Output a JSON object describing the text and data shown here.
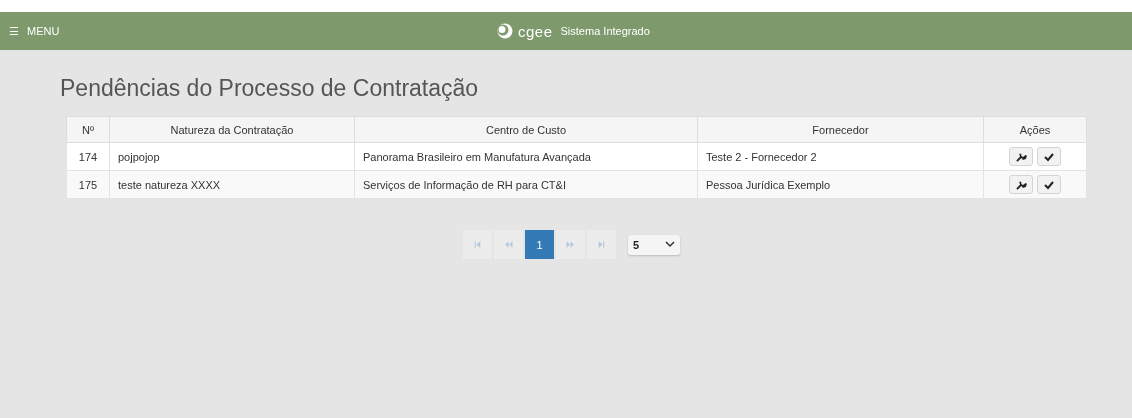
{
  "header": {
    "menu_icon": "☰",
    "menu_label": "MENU",
    "brand": "cgee",
    "app_name": "Sistema Integrado"
  },
  "title": "Pendências do Processo de Contratação",
  "table": {
    "columns": [
      "Nº",
      "Natureza da Contratação",
      "Centro de Custo",
      "Fornecedor",
      "Ações"
    ],
    "rows": [
      {
        "number": "174",
        "nature": "pojpojop",
        "cost_center": "Panorama Brasileiro em Manufatura Avançada",
        "supplier": "Teste 2 - Fornecedor 2"
      },
      {
        "number": "175",
        "nature": "teste natureza XXXX",
        "cost_center": "Serviços de Informação de RH para CT&I",
        "supplier": "Pessoa Jurídica Exemplo"
      }
    ]
  },
  "pagination": {
    "first_disabled": true,
    "prev_disabled": true,
    "next_disabled": true,
    "last_disabled": true,
    "pages": [
      {
        "label": "1",
        "selected": true
      }
    ],
    "page_size": "5"
  }
}
